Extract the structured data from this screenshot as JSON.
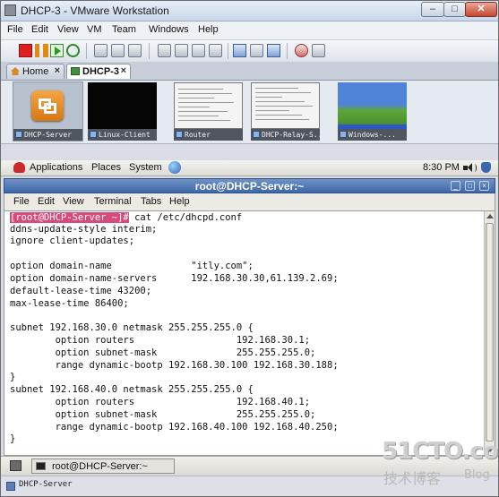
{
  "window": {
    "title": "DHCP-3 - VMware Workstation"
  },
  "menubar": {
    "items": [
      "File",
      "Edit",
      "View",
      "VM",
      "Team",
      "Windows",
      "Help"
    ]
  },
  "tabs": [
    {
      "label": "Home"
    },
    {
      "label": "DHCP-3"
    }
  ],
  "thumbnails": [
    {
      "label": "DHCP-Server"
    },
    {
      "label": "Linux-Client"
    },
    {
      "label": "Router"
    },
    {
      "label": "DHCP-Relay-S..."
    },
    {
      "label": "Windows-..."
    }
  ],
  "gnome_panel": {
    "applications": "Applications",
    "places": "Places",
    "system": "System",
    "clock": "8:30 PM"
  },
  "terminal": {
    "title": "root@DHCP-Server:~",
    "menu": [
      "File",
      "Edit",
      "View",
      "Terminal",
      "Tabs",
      "Help"
    ],
    "prompt": "[root@DHCP-Server ~]#",
    "command": " cat /etc/dhcpd.conf",
    "lines": [
      "ddns-update-style interim;",
      "ignore client-updates;",
      "",
      "option domain-name              \"itly.com\";",
      "option domain-name-servers      192.168.30.30,61.139.2.69;",
      "default-lease-time 43200;",
      "max-lease-time 86400;",
      "",
      "subnet 192.168.30.0 netmask 255.255.255.0 {",
      "        option routers                  192.168.30.1;",
      "        option subnet-mask              255.255.255.0;",
      "        range dynamic-bootp 192.168.30.100 192.168.30.188;",
      "}",
      "subnet 192.168.40.0 netmask 255.255.255.0 {",
      "        option routers                  192.168.40.1;",
      "        option subnet-mask              255.255.255.0;",
      "        range dynamic-bootp 192.168.40.100 192.168.40.250;",
      "}"
    ]
  },
  "taskbar": {
    "label": "root@DHCP-Server:~"
  },
  "statusbar": {
    "text": "DHCP-Server"
  },
  "watermark": {
    "top": "51CTO.com",
    "bottom": "技术博客",
    "blog": "Blog"
  }
}
